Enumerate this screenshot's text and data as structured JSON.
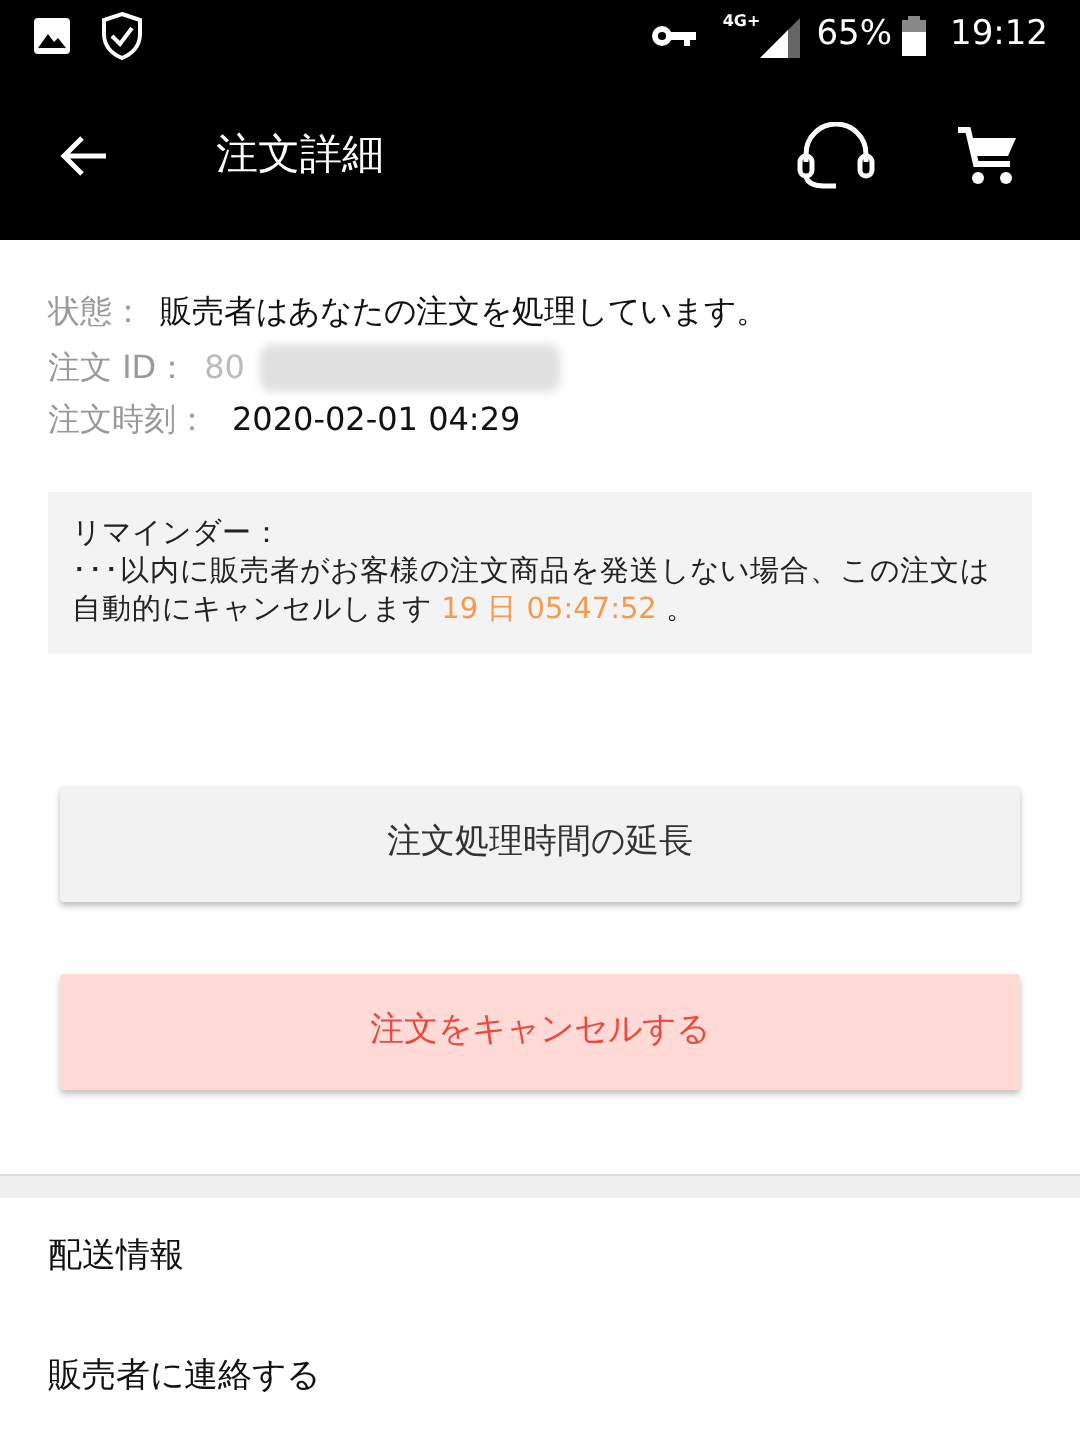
{
  "status_bar": {
    "battery": "65%",
    "time": "19:12",
    "network": "4G+"
  },
  "app_bar": {
    "title": "注文詳細"
  },
  "order": {
    "status_label": "状態：",
    "status": "販売者はあなたの注文を処理しています。",
    "id_label": "注文 ID：",
    "id_visible": "80",
    "time_label": "注文時刻：",
    "time": "2020-02-01 04:29"
  },
  "reminder": {
    "title": "リマインダー：",
    "message": "･･･以内に販売者がお客様の注文商品を発送しない場合、この注文は自動的にキャンセルします ",
    "countdown": "19 日 05:47:52",
    "end": " 。"
  },
  "buttons": [
    {
      "label": "注文処理時間の延長",
      "kind": "neutral"
    },
    {
      "label": "注文をキャンセルする",
      "kind": "danger"
    }
  ],
  "menu": [
    {
      "label": "配送情報"
    },
    {
      "label": "販売者に連絡する"
    }
  ]
}
